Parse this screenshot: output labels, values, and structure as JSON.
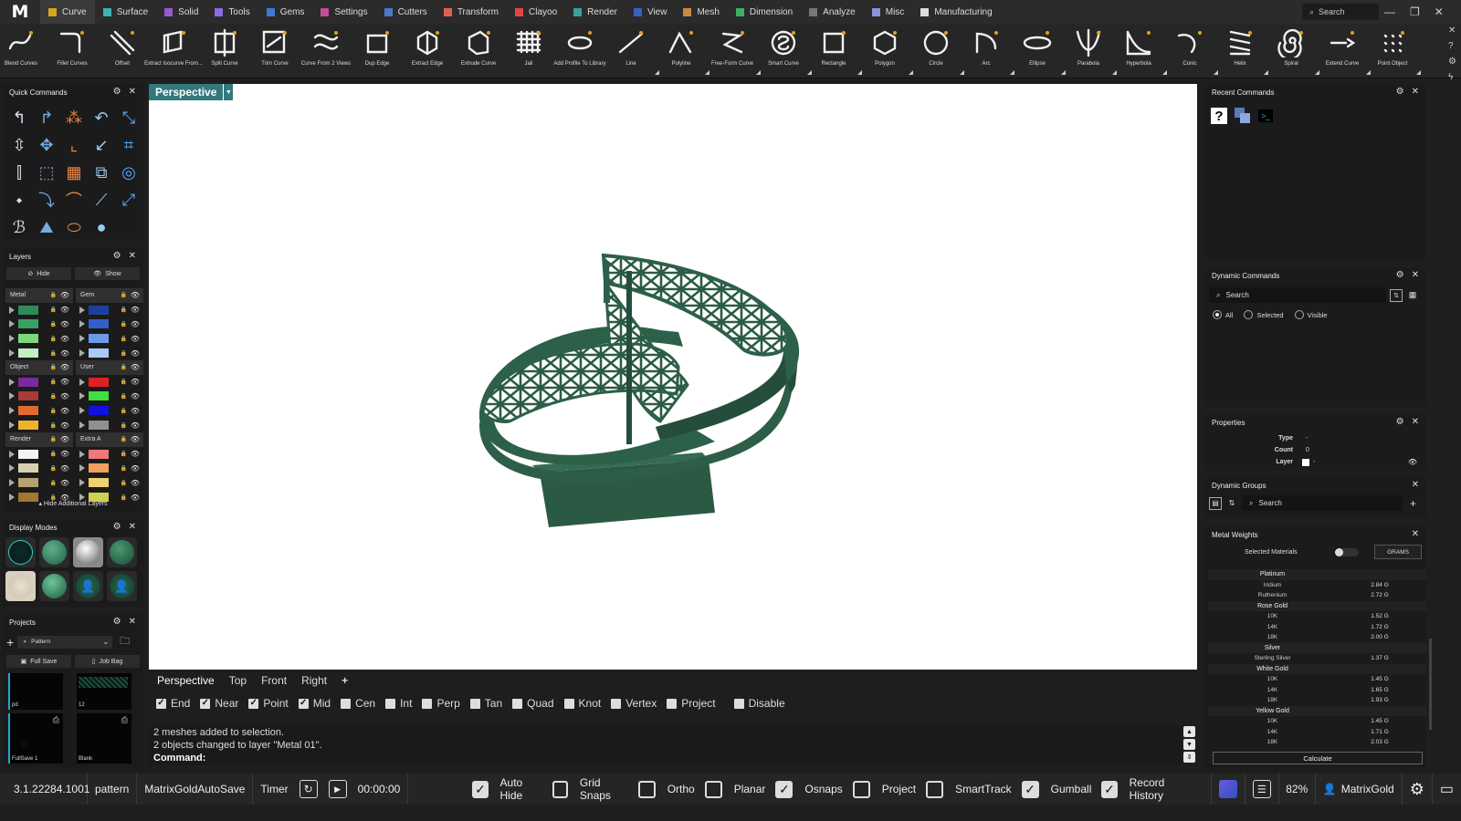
{
  "app": {
    "logo": "M"
  },
  "menu": {
    "tabs": [
      {
        "label": "Curve",
        "color": "#d9a520",
        "active": true
      },
      {
        "label": "Surface",
        "color": "#3fb1b1"
      },
      {
        "label": "Solid",
        "color": "#9b59d0"
      },
      {
        "label": "Tools",
        "color": "#8a6de0"
      },
      {
        "label": "Gems",
        "color": "#3a7cd4"
      },
      {
        "label": "Settings",
        "color": "#c44b9b"
      },
      {
        "label": "Cutters",
        "color": "#4a78c8"
      },
      {
        "label": "Transform",
        "color": "#e06050"
      },
      {
        "label": "Clayoo",
        "color": "#e04848"
      },
      {
        "label": "Render",
        "color": "#38a0a0"
      },
      {
        "label": "View",
        "color": "#3860c0"
      },
      {
        "label": "Mesh",
        "color": "#d08840"
      },
      {
        "label": "Dimension",
        "color": "#40b060"
      },
      {
        "label": "Analyze",
        "color": "#777777"
      },
      {
        "label": "Misc",
        "color": "#9090e0"
      },
      {
        "label": "Manufacturing",
        "color": "#dddddd"
      }
    ],
    "search": "Search"
  },
  "toolbar": {
    "tools": [
      {
        "label": "Blend Curves",
        "icon": "blend-curves"
      },
      {
        "label": "Fillet Curves",
        "icon": "fillet-curves"
      },
      {
        "label": "Offset",
        "icon": "offset"
      },
      {
        "label": "Extract Isocurve From...",
        "icon": "extract-isocurve"
      },
      {
        "label": "Split Curve",
        "icon": "split-curve"
      },
      {
        "label": "Trim Curve",
        "icon": "trim-curve"
      },
      {
        "label": "Curve From 2 Views",
        "icon": "curve-from-2-views"
      },
      {
        "label": "Dup Edge",
        "icon": "dup-edge"
      },
      {
        "label": "Extract Edge",
        "icon": "extract-edge"
      },
      {
        "label": "Extrude Curve",
        "icon": "extrude-curve"
      },
      {
        "label": "Jali",
        "icon": "jali"
      },
      {
        "label": "Add Profile To Library",
        "icon": "add-profile"
      },
      {
        "label": "Line",
        "icon": "line"
      },
      {
        "label": "Polyline",
        "icon": "polyline"
      },
      {
        "label": "Free-Form Curve",
        "icon": "free-form-curve"
      },
      {
        "label": "Smart Curve",
        "icon": "smart-curve"
      },
      {
        "label": "Rectangle",
        "icon": "rectangle"
      },
      {
        "label": "Polygon",
        "icon": "polygon"
      },
      {
        "label": "Circle",
        "icon": "circle"
      },
      {
        "label": "Arc",
        "icon": "arc"
      },
      {
        "label": "Ellipse",
        "icon": "ellipse"
      },
      {
        "label": "Parabola",
        "icon": "parabola"
      },
      {
        "label": "Hyperbola",
        "icon": "hyperbola"
      },
      {
        "label": "Conic",
        "icon": "conic"
      },
      {
        "label": "Helix",
        "icon": "helix"
      },
      {
        "label": "Spiral",
        "icon": "spiral"
      },
      {
        "label": "Extend Curve",
        "icon": "extend-curve"
      },
      {
        "label": "Point Object",
        "icon": "point-object"
      }
    ]
  },
  "quick_commands": {
    "title": "Quick Commands"
  },
  "layers": {
    "title": "Layers",
    "hide": "Hide",
    "show": "Show",
    "groups": [
      {
        "name": "Metal",
        "colors": [
          "#2e8b57",
          "#3aa060",
          "#7cd67c",
          "#c0f0c0"
        ]
      },
      {
        "name": "Gem",
        "colors": [
          "#1f3fa0",
          "#3060c8",
          "#6d9ae8",
          "#a8c8f8"
        ]
      },
      {
        "name": "Object",
        "colors": [
          "#7a2aa0",
          "#a83a3a",
          "#e06a30",
          "#f0b030"
        ]
      },
      {
        "name": "User",
        "colors": [
          "#e02020",
          "#40e040",
          "#1010e0",
          "#909090"
        ]
      },
      {
        "name": "Render",
        "colors": [
          "#f4f4f4",
          "#d8cfb0",
          "#b8a070",
          "#a07830"
        ]
      },
      {
        "name": "Extra A",
        "colors": [
          "#f07878",
          "#f0a060",
          "#f0d070",
          "#d0d050"
        ]
      }
    ],
    "hide_additional": "Hide Additional Layers"
  },
  "display_modes": {
    "title": "Display Modes"
  },
  "projects": {
    "title": "Projects",
    "select": "Pattern",
    "full_save": "Full Save",
    "job_bag": "Job Bag",
    "thumbs": [
      "pd",
      "12",
      "FullSave 1",
      "Blank"
    ]
  },
  "viewport": {
    "active": "Perspective",
    "tabs": [
      "Perspective",
      "Top",
      "Front",
      "Right"
    ],
    "add": "+"
  },
  "snaps": [
    {
      "label": "End",
      "checked": true
    },
    {
      "label": "Near",
      "checked": true
    },
    {
      "label": "Point",
      "checked": true
    },
    {
      "label": "Mid",
      "checked": true
    },
    {
      "label": "Cen",
      "checked": false
    },
    {
      "label": "Int",
      "checked": false
    },
    {
      "label": "Perp",
      "checked": false
    },
    {
      "label": "Tan",
      "checked": false
    },
    {
      "label": "Quad",
      "checked": false
    },
    {
      "label": "Knot",
      "checked": false
    },
    {
      "label": "Vertex",
      "checked": false
    },
    {
      "label": "Project",
      "checked": false
    },
    {
      "label": "Disable",
      "checked": false
    }
  ],
  "command": {
    "history": [
      "2 meshes added to selection.",
      "2 objects changed to layer \"Metal 01\"."
    ],
    "prompt": "Command:"
  },
  "status": {
    "version": "3.1.22284.1001",
    "file": "pattern",
    "autosave": "MatrixGoldAutoSave",
    "timer_label": "Timer",
    "time": "00:00:00",
    "toggles": [
      {
        "label": "Auto Hide",
        "checked": true
      },
      {
        "label": "Grid Snaps",
        "checked": false
      },
      {
        "label": "Ortho",
        "checked": false
      },
      {
        "label": "Planar",
        "checked": false
      },
      {
        "label": "Osnaps",
        "checked": true
      },
      {
        "label": "Project",
        "checked": false
      },
      {
        "label": "SmartTrack",
        "checked": false
      },
      {
        "label": "Gumball",
        "checked": true
      },
      {
        "label": "Record History",
        "checked": true
      }
    ],
    "zoom": "82%",
    "user": "MatrixGold"
  },
  "recent_commands": {
    "title": "Recent Commands"
  },
  "dynamic_commands": {
    "title": "Dynamic Commands",
    "search": "Search",
    "filters": [
      {
        "label": "All",
        "selected": true
      },
      {
        "label": "Selected",
        "selected": false
      },
      {
        "label": "Visible",
        "selected": false
      }
    ]
  },
  "properties": {
    "title": "Properties",
    "rows": [
      {
        "key": "Type",
        "value": "-"
      },
      {
        "key": "Count",
        "value": "0"
      },
      {
        "key": "Layer",
        "value": "-"
      }
    ]
  },
  "dynamic_groups": {
    "title": "Dynamic Groups",
    "search": "Search"
  },
  "metal_weights": {
    "title": "Metal Weights",
    "selected_materials": "Selected Materials",
    "unit": "GRAMS",
    "rows": [
      {
        "name": "Platinum",
        "weight": "",
        "header": true
      },
      {
        "name": "Iridium",
        "weight": "2.84 G"
      },
      {
        "name": "Ruthenium",
        "weight": "2.72 G"
      },
      {
        "name": "Rose Gold",
        "weight": "",
        "header": true
      },
      {
        "name": "10K",
        "weight": "1.52 G"
      },
      {
        "name": "14K",
        "weight": "1.72 G"
      },
      {
        "name": "18K",
        "weight": "2.00 G"
      },
      {
        "name": "Silver",
        "weight": "",
        "header": true
      },
      {
        "name": "Sterling Silver",
        "weight": "1.37 G"
      },
      {
        "name": "White Gold",
        "weight": "",
        "header": true
      },
      {
        "name": "10K",
        "weight": "1.45 G"
      },
      {
        "name": "14K",
        "weight": "1.65 G"
      },
      {
        "name": "18K",
        "weight": "1.93 G"
      },
      {
        "name": "Yellow Gold",
        "weight": "",
        "header": true
      },
      {
        "name": "10K",
        "weight": "1.45 G"
      },
      {
        "name": "14K",
        "weight": "1.71 G"
      },
      {
        "name": "18K",
        "weight": "2.03 G"
      }
    ],
    "calculate": "Calculate"
  }
}
